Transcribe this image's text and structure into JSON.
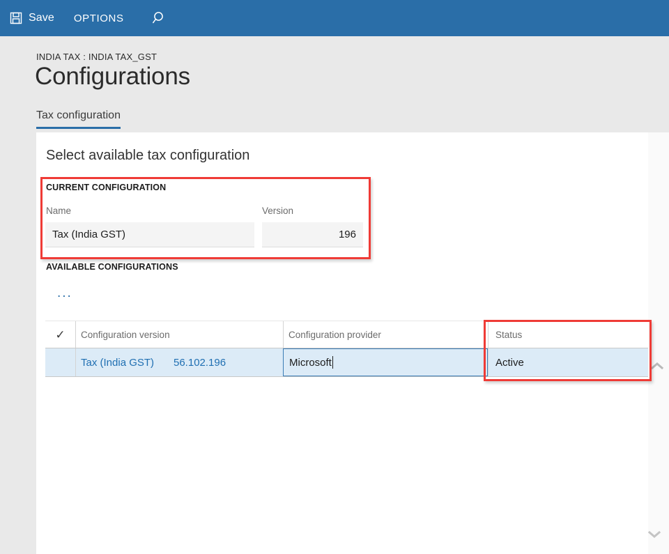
{
  "toolbar": {
    "save_label": "Save",
    "save_icon": "save-floppy-icon",
    "options_label": "OPTIONS",
    "search_icon": "search-icon"
  },
  "header": {
    "breadcrumb": "INDIA TAX : INDIA TAX_GST",
    "title": "Configurations",
    "tabs": [
      {
        "label": "Tax configuration",
        "active": true
      }
    ]
  },
  "main": {
    "section_title": "Select available tax configuration",
    "current_configuration": {
      "group_label": "CURRENT CONFIGURATION",
      "name_label": "Name",
      "name_value": "Tax (India GST)",
      "version_label": "Version",
      "version_value": "196"
    },
    "available_configurations": {
      "group_label": "AVAILABLE CONFIGURATIONS",
      "overflow_menu_label": "...",
      "columns": [
        {
          "label": "",
          "icon": "checkmark-icon"
        },
        {
          "label": "Configuration version"
        },
        {
          "label": "Configuration provider"
        },
        {
          "label": "Status"
        }
      ],
      "rows": [
        {
          "selected": true,
          "configuration_version_name": "Tax (India GST)",
          "configuration_version_number": "56.102.196",
          "configuration_provider": "Microsoft",
          "provider_editing": true,
          "status": "Active"
        }
      ]
    }
  },
  "scroll": {
    "up_icon": "chevron-up-icon",
    "down_icon": "chevron-down-icon"
  },
  "annotations": [
    {
      "name": "current-configuration-highlight",
      "color": "#ef3b36"
    },
    {
      "name": "status-column-highlight",
      "color": "#ef3b36"
    }
  ],
  "colors": {
    "brand_blue": "#2a6ea8",
    "header_band": "#e9e9e9",
    "selected_row": "#dcebf7",
    "link_blue": "#1f6fb2",
    "annotation_red": "#ef3b36"
  }
}
